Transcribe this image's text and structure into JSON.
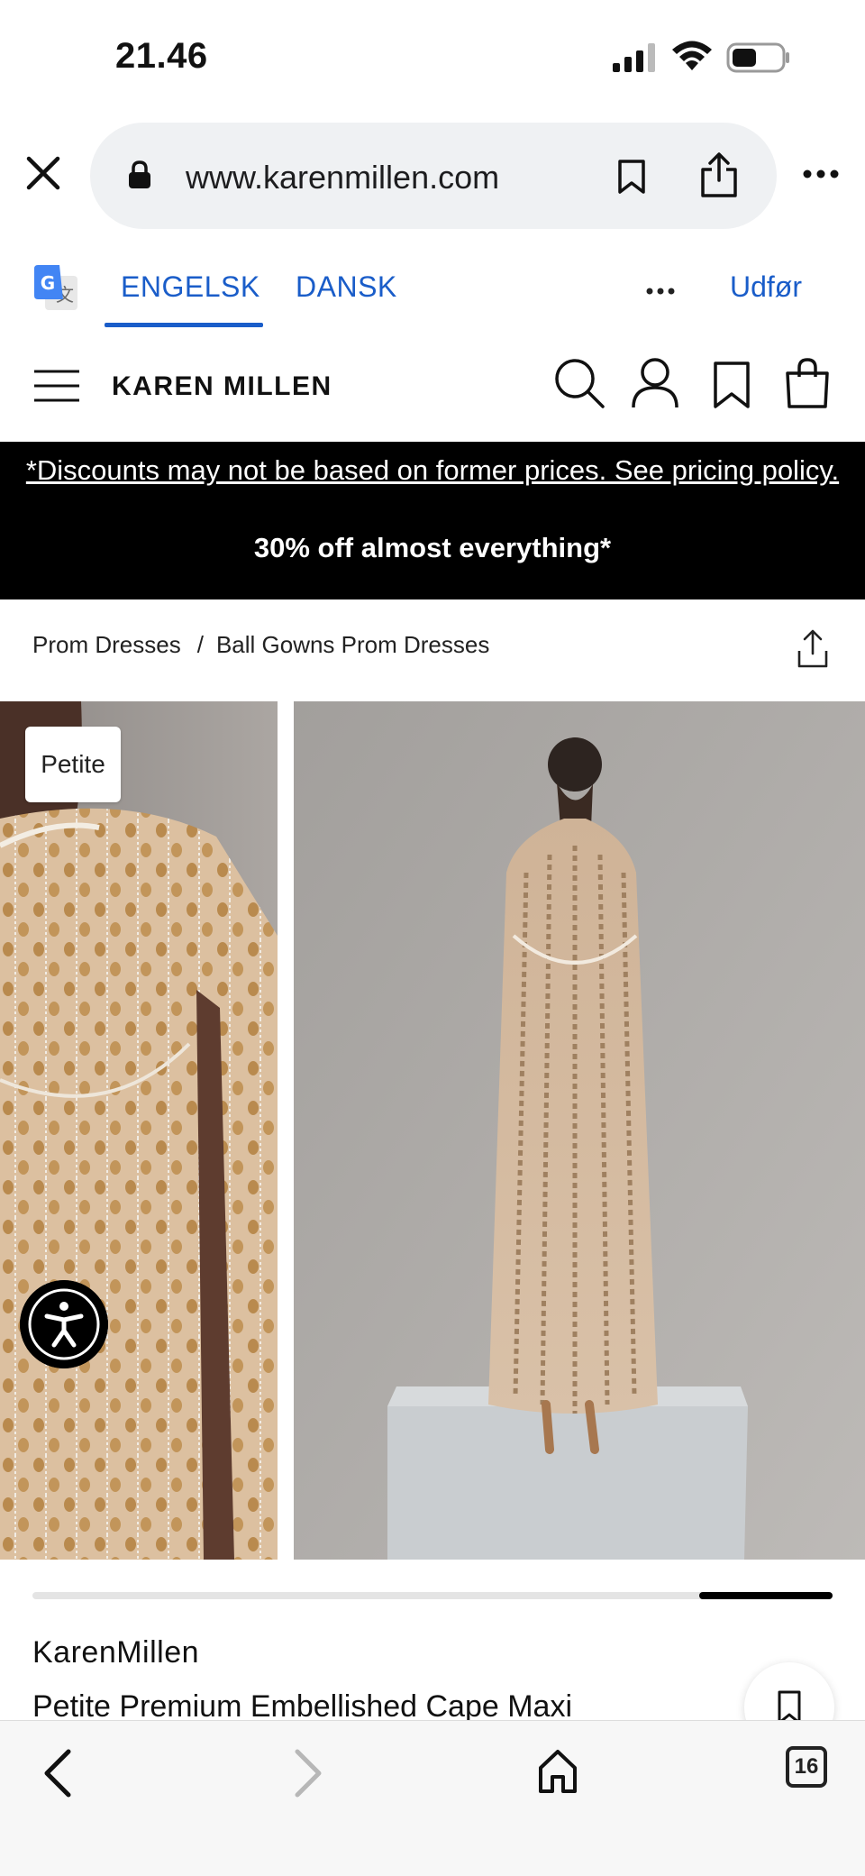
{
  "status_bar": {
    "time": "21.46",
    "signal_icon": "cellular-signal-icon",
    "wifi_icon": "wifi-icon",
    "battery_icon": "battery-icon"
  },
  "browser": {
    "url": "www.karenmillen.com",
    "close_icon": "close-icon",
    "lock_icon": "lock-icon",
    "bookmark_icon": "bookmark-icon",
    "share_icon": "share-icon",
    "more_icon": "more-icon"
  },
  "translate_bar": {
    "icon": "google-translate-icon",
    "tabs": [
      {
        "label": "ENGELSK",
        "active": true
      },
      {
        "label": "DANSK",
        "active": false
      }
    ],
    "more_icon": "more-horizontal-icon",
    "action_label": "Udfør",
    "accent_color": "#1a5dc9"
  },
  "site_header": {
    "logo": "KAREN MILLEN",
    "menu_icon": "hamburger-menu-icon",
    "search_icon": "search-icon",
    "account_icon": "account-icon",
    "wishlist_icon": "wishlist-icon",
    "bag_icon": "shopping-bag-icon"
  },
  "promo_banner": {
    "policy_link": "*Discounts may not be based on former prices. See pricing policy.",
    "offer": "30% off almost everything*",
    "background_color": "#000000"
  },
  "breadcrumb": {
    "items": [
      "Prom Dresses",
      "Ball Gowns Prom Dresses"
    ],
    "separator": "/",
    "share_icon": "share-icon"
  },
  "gallery": {
    "badge": "Petite",
    "accessibility_icon": "accessibility-icon",
    "scroll_progress": 0.17
  },
  "product": {
    "brand": "KarenMillen",
    "name": "Petite Premium Embellished Cape Maxi",
    "wishlist_icon": "bookmark-icon"
  },
  "bottom_bar": {
    "back_icon": "chevron-left-icon",
    "forward_icon": "chevron-right-icon",
    "home_icon": "home-icon",
    "tab_count": "16"
  }
}
